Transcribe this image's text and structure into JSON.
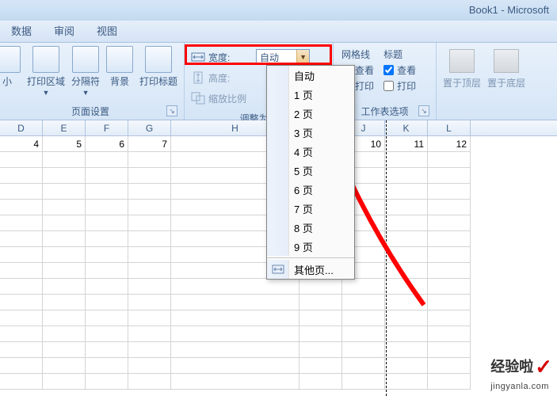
{
  "title": "Book1 - Microsoft",
  "menu": {
    "data": "数据",
    "review": "审阅",
    "view": "视图"
  },
  "page_setup_group": {
    "margins_partial": "小",
    "print_area": "打印区域",
    "breaks": "分隔符",
    "background": "背景",
    "print_titles": "打印标题",
    "label": "页面设置"
  },
  "scale_group": {
    "width_label": "宽度:",
    "width_value": "自动",
    "height_label": "高度:",
    "scale_label": "缩放比例",
    "group_label": "调整为合"
  },
  "gridlines": {
    "title": "网格线",
    "view": "查看",
    "print": "打印",
    "view_checked": true,
    "print_checked": false
  },
  "headings": {
    "title": "标题",
    "view": "查看",
    "print": "打印",
    "view_checked": true,
    "print_checked": false
  },
  "sheet_options_label": "工作表选项",
  "arrange": {
    "front": "置于顶层",
    "back": "置于底层"
  },
  "dropdown": {
    "items": [
      "自动",
      "1 页",
      "2 页",
      "3 页",
      "4 页",
      "5 页",
      "6 页",
      "7 页",
      "8 页",
      "9 页"
    ],
    "other": "其他页..."
  },
  "columns": [
    "D",
    "E",
    "F",
    "G",
    "H",
    "",
    "J",
    "K",
    "L"
  ],
  "data_row": [
    "4",
    "5",
    "6",
    "7",
    "",
    "",
    "10",
    "11",
    "12"
  ],
  "watermark": {
    "main": "经验啦",
    "sub": "jingyanla.com"
  }
}
